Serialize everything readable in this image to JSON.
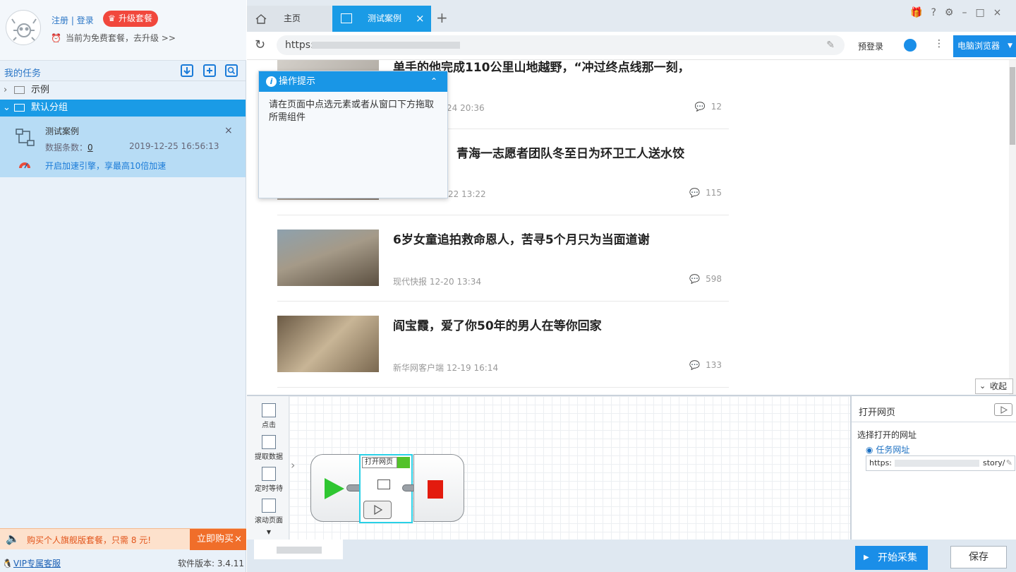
{
  "account": {
    "register": "注册",
    "separator": "|",
    "login": "登录",
    "upgrade_label": "升级套餐",
    "plan_text": "当前为免费套餐，去升级 >>"
  },
  "tasks": {
    "title": "我的任务",
    "groups": [
      {
        "label": "示例",
        "expanded": false
      },
      {
        "label": "默认分组",
        "expanded": true
      }
    ],
    "task": {
      "name": "测试案例",
      "count_label": "数据条数：",
      "count": "0",
      "date": "2019-12-25 16:56:13",
      "accel": "开启加速引擎，享最高10倍加速"
    }
  },
  "promo": {
    "text": "购买个人旗舰版套餐，只需 8 元!",
    "button": "立即购买"
  },
  "footer": {
    "vip": "VIP专属客服",
    "version": "软件版本: 3.4.11"
  },
  "tabs": [
    {
      "label": "主页"
    },
    {
      "label": "测试案例"
    }
  ],
  "address": {
    "url": "https:",
    "prelogin": "预登录",
    "browser_button": "电脑浏览器"
  },
  "tip": {
    "title": "操作提示",
    "body": "请在页面中点选元素或者从窗口下方拖取所需组件"
  },
  "news": [
    {
      "title": "单手的他完成110公里山地越野，“冲过终点线那一刻，",
      "meta": "24 20:36",
      "comments": "12"
    },
    {
      "title": "青海一志愿者团队冬至日为环卫工人送水饺",
      "meta": "2-22 13:22",
      "comments": "115"
    },
    {
      "title": "6岁女童追拍救命恩人，苦寻5个月只为当面道谢",
      "meta": "现代快报   12-20 13:34",
      "comments": "598"
    },
    {
      "title": "阎宝霞，爱了你50年的男人在等你回家",
      "meta": "新华网客户端   12-19 16:14",
      "comments": "133"
    }
  ],
  "collapse_label": "收起",
  "toolbox": [
    {
      "label": "点击",
      "icon": "click-icon"
    },
    {
      "label": "提取数据",
      "icon": "extract-icon"
    },
    {
      "label": "定时等待",
      "icon": "hourglass-icon"
    },
    {
      "label": "滚动页面",
      "icon": "scroll-icon"
    }
  ],
  "workflow": {
    "node_label": "打开网页"
  },
  "properties": {
    "title": "打开网页",
    "section": "选择打开的网址",
    "option": "任务网址",
    "url_start": "https:",
    "url_end": "story/"
  },
  "actions": {
    "start": "开始采集",
    "save": "保存"
  },
  "colors": {
    "accent": "#1a8ee8",
    "promo": "#f06e2a",
    "upgrade": "#f1473c",
    "selected_group": "#1a9be6"
  }
}
